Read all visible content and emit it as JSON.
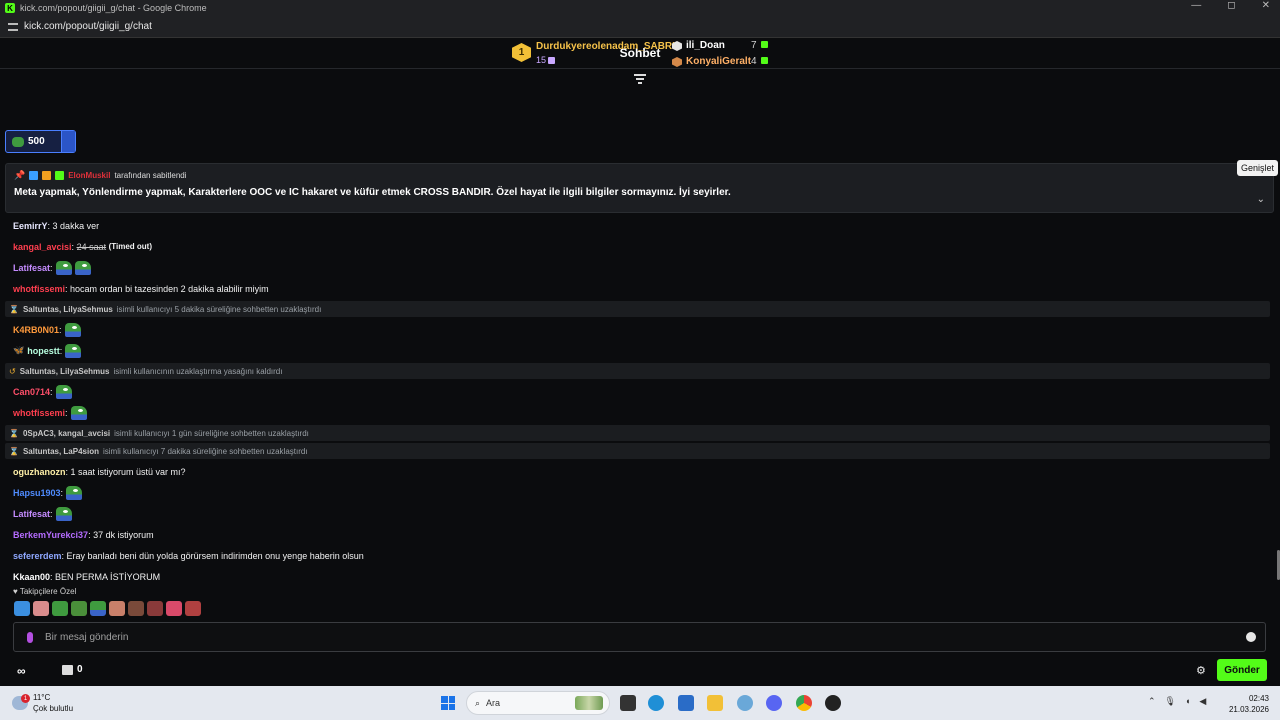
{
  "browser": {
    "title": "kick.com/popout/giigii_g/chat - Google Chrome",
    "url": "kick.com/popout/giigii_g/chat",
    "controls": [
      "—",
      "◻",
      "✕"
    ]
  },
  "chat": {
    "header_title": "Sohbet",
    "leaderboard": {
      "first": {
        "rank": "1",
        "name": "Durdukyereolenadam_SABRI",
        "count": "15"
      },
      "second": {
        "name": "ili_Doan",
        "count": "7"
      },
      "third": {
        "name": "KonyaliGeralt",
        "count": "4"
      }
    },
    "goal": {
      "value": "500"
    },
    "pinned": {
      "pinned_by_user": "ElonMuskil",
      "pinned_by_suffix": "tarafından sabitlendi",
      "message": "Meta yapmak, Yönlendirme yapmak, Karakterlere OOC ve IC hakaret ve küfür etmek CROSS BANDIR. Özel hayat ile ilgili bilgiler sormayınız. İyi seyirler.",
      "tooltip": "Genişlet"
    },
    "messages": [
      {
        "user": "EemirrY",
        "color": "#e8e8ff",
        "text": "3 dakka ver"
      },
      {
        "user": "kangal_avcisi",
        "color": "#ff3f4f",
        "text": "24 saat",
        "extra": "(Timed out)"
      },
      {
        "user": "Latifesat",
        "color": "#c58cff",
        "text": ""
      },
      {
        "user": "whotfissemi",
        "color": "#ff3f4f",
        "text": "hocam ordan bi tazesinden 2 dakika alabilir miyim"
      },
      {
        "user": "K4RB0N01",
        "color": "#ff9a3c",
        "text": ""
      },
      {
        "user": "hopestt",
        "color": "#b8ffe0",
        "text": ""
      },
      {
        "user": "Can0714",
        "color": "#ff4f6a",
        "text": ""
      },
      {
        "user": "whotfissemi",
        "color": "#ff3f4f",
        "text": ""
      },
      {
        "user": "oguzhanozn",
        "color": "#fff0a8",
        "text": "1 saat istiyorum üstü var mı?"
      },
      {
        "user": "Hapsu1903",
        "color": "#4f8cff",
        "text": ""
      },
      {
        "user": "Latifesat",
        "color": "#c58cff",
        "text": ""
      },
      {
        "user": "BerkemYurekci37",
        "color": "#b56cff",
        "text": "37 dk istiyorum"
      },
      {
        "user": "sefererdem",
        "color": "#8fa8ff",
        "text": "Eray banladı beni dün yolda görürsem indirimden onu yenge haberin olsun"
      },
      {
        "user": "Kkaan00",
        "color": "#ffffff",
        "text": "BEN PERMA İSTİYORUM"
      }
    ],
    "system": [
      {
        "users": "Saltuntas, LilyaSehmus",
        "text": "isimli kullanıcıyı 5 dakika süreliğine sohbetten uzaklaştırdı"
      },
      {
        "users": "Saltuntas, LilyaSehmus",
        "text": "isimli kullanıcının uzaklaştırma yasağını kaldırdı"
      },
      {
        "users": "0SpAC3, kangal_avcisi",
        "text": "isimli kullanıcıyı 1 gün süreliğine sohbetten uzaklaştırdı"
      },
      {
        "users": "Saltuntas, LaP4sion",
        "text": "isimli kullanıcıyı 7 dakika süreliğine sohbetten uzaklaştırdı"
      }
    ],
    "follower_label": "Takipçilere Özel",
    "input_placeholder": "Bir mesaj gönderin",
    "infinity": "∞",
    "store_count": "0",
    "send_label": "Gönder"
  },
  "taskbar": {
    "temperature": "11°C",
    "weather": "Çok bulutlu",
    "search_label": "Ara",
    "time": "02:43",
    "date": "21.03.2026",
    "weather_badge": "1"
  }
}
